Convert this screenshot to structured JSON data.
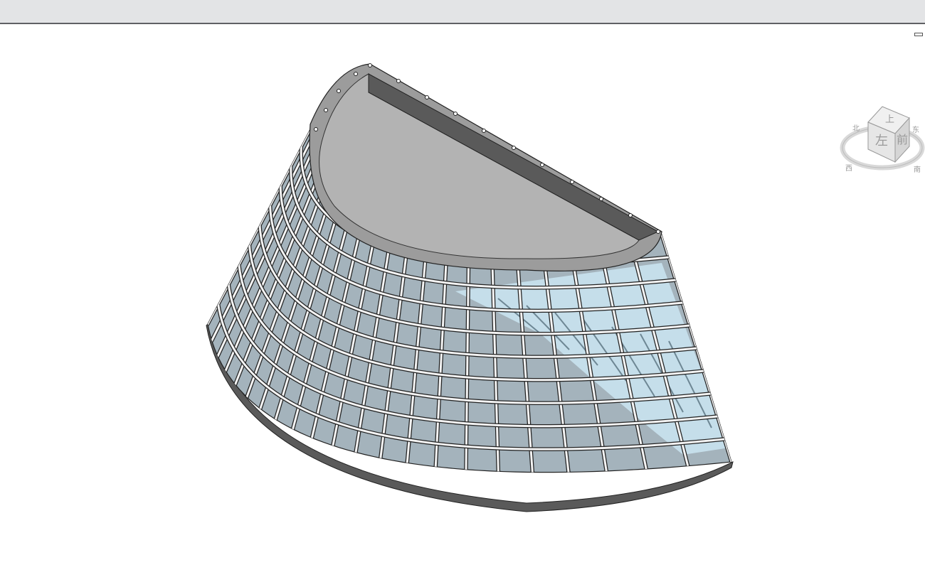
{
  "window": {
    "title_bar_text": ""
  },
  "viewport": {
    "view_mode": "3D",
    "model": "curved-glass-curtain-wall-canopy"
  },
  "viewcube": {
    "faces": {
      "top": "上",
      "front": "前",
      "left": "左"
    },
    "compass": {
      "north": "北",
      "south": "南",
      "east": "东",
      "west": "西"
    }
  },
  "colors": {
    "titlebar": "#e3e4e6",
    "glass": "#a4b3bc",
    "glass_light": "#c9e2ee",
    "roof_slab": "#b3b3b3",
    "parapet": "#5a5a5a",
    "mullion": "#f4f4f4"
  },
  "icons": [
    "minimize-icon",
    "viewcube-icon"
  ]
}
